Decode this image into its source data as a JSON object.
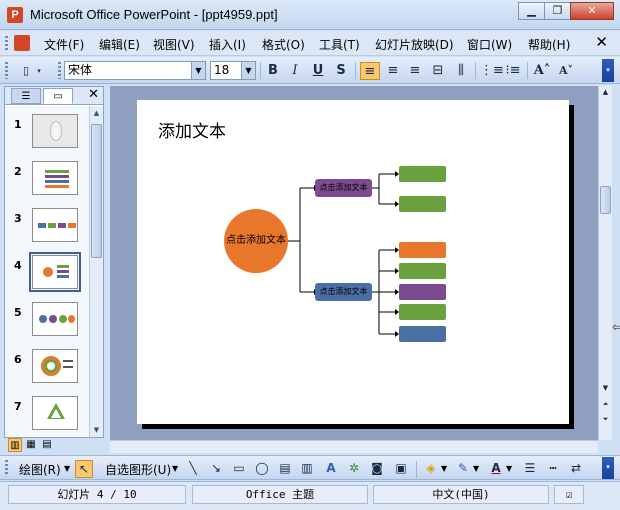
{
  "window": {
    "title": "Microsoft Office PowerPoint - [ppt4959.ppt]",
    "app_icon": "P",
    "minimize": "▁",
    "maximize": "❐",
    "close": "✕"
  },
  "menu": {
    "items": [
      "文件(F)",
      "编辑(E)",
      "视图(V)",
      "插入(I)",
      "格式(O)",
      "工具(T)",
      "幻灯片放映(D)",
      "窗口(W)",
      "帮助(H)"
    ],
    "close": "✕"
  },
  "format_toolbar": {
    "font_name": "宋体",
    "font_size": "18",
    "bold": "B",
    "italic": "I",
    "underline": "U",
    "shadow": "S",
    "grow_font": "A˄",
    "shrink_font": "A˅"
  },
  "slides_panel": {
    "numbers": [
      "1",
      "2",
      "3",
      "4",
      "5",
      "6",
      "7"
    ],
    "selected": 4,
    "close": "✕"
  },
  "slide": {
    "title": "添加文本",
    "center_text": "点击添加文本",
    "upper_node": "点击添加文本",
    "lower_node": "点击添加文本",
    "colors": {
      "orange": "#e8772b",
      "purple": "#7a4b8e",
      "blue": "#4a6fa5",
      "green": "#6aa13f"
    }
  },
  "drawing_toolbar": {
    "draw": "绘图(R)",
    "autoshapes": "自选图形(U)"
  },
  "status": {
    "slide": "幻灯片 4 / 10",
    "theme": "Office 主题",
    "language": "中文(中国)"
  }
}
